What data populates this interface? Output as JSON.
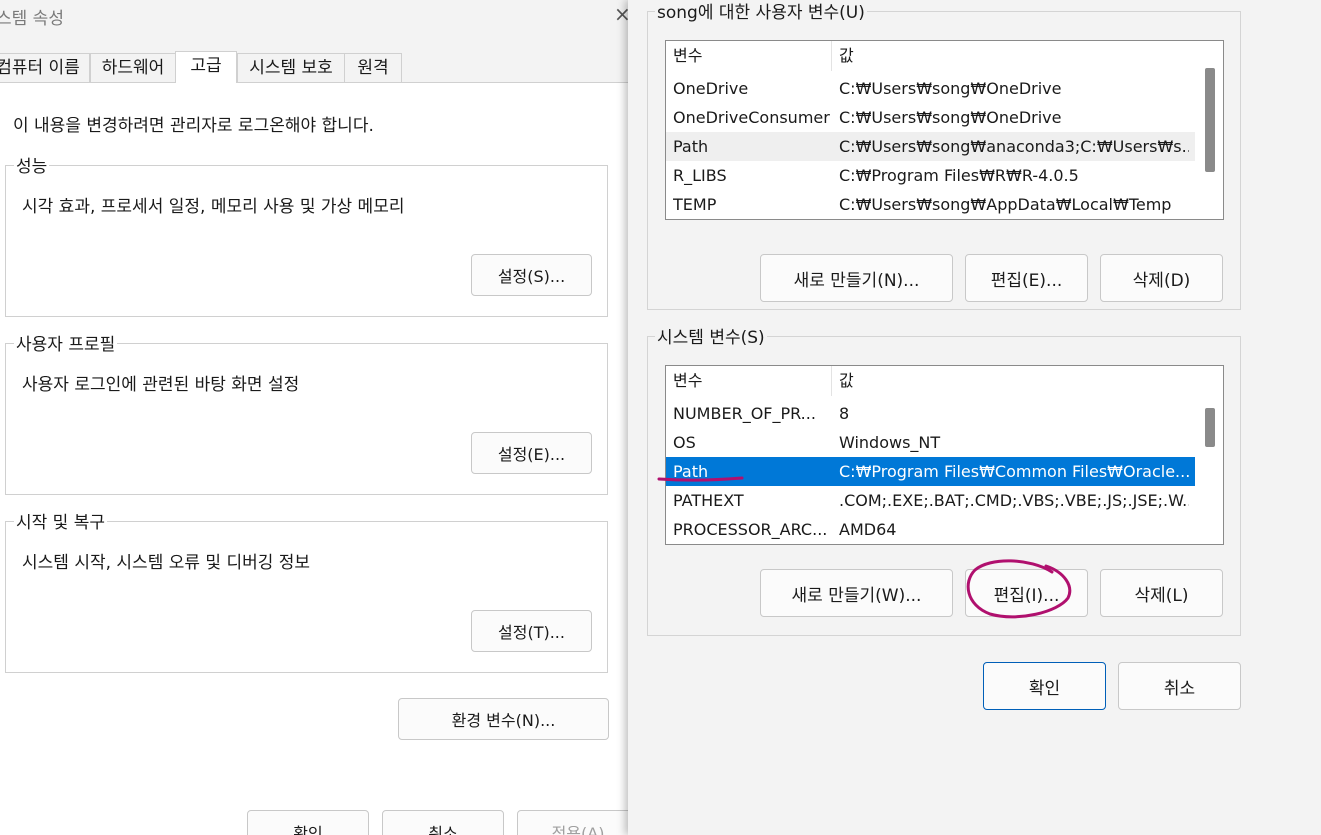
{
  "system_properties": {
    "title": "스템 속성",
    "close_icon": "×",
    "tabs": [
      "컴퓨터 이름",
      "하드웨어",
      "고급",
      "시스템 보호",
      "원격"
    ],
    "active_tab": "고급",
    "admin_note": "이 내용을 변경하려면 관리자로 로그온해야 합니다.",
    "groups": [
      {
        "label": "성능",
        "description": "시각 효과, 프로세서 일정, 메모리 사용 및 가상 메모리",
        "button": "설정(S)..."
      },
      {
        "label": "사용자 프로필",
        "description": "사용자 로그인에 관련된 바탕 화면 설정",
        "button": "설정(E)..."
      },
      {
        "label": "시작 및 복구",
        "description": "시스템 시작, 시스템 오류 및 디버깅 정보",
        "button": "설정(T)..."
      }
    ],
    "env_vars_button": "환경 변수(N)...",
    "footer_buttons": {
      "ok": "확인",
      "cancel": "취소",
      "apply": "적용(A)"
    }
  },
  "environment_variables": {
    "user_vars": {
      "label": "song에 대한 사용자 변수(U)",
      "columns": [
        "변수",
        "값"
      ],
      "rows": [
        {
          "name": "OneDrive",
          "value": "C:₩Users₩song₩OneDrive"
        },
        {
          "name": "OneDriveConsumer",
          "value": "C:₩Users₩song₩OneDrive"
        },
        {
          "name": "Path",
          "value": "C:₩Users₩song₩anaconda3;C:₩Users₩s..."
        },
        {
          "name": "R_LIBS",
          "value": "C:₩Program Files₩R₩R-4.0.5"
        },
        {
          "name": "TEMP",
          "value": "C:₩Users₩song₩AppData₩Local₩Temp"
        }
      ],
      "buttons": {
        "new": "새로 만들기(N)...",
        "edit": "편집(E)...",
        "delete": "삭제(D)"
      }
    },
    "system_vars": {
      "label": "시스템 변수(S)",
      "columns": [
        "변수",
        "값"
      ],
      "rows": [
        {
          "name": "NUMBER_OF_PR...",
          "value": "8"
        },
        {
          "name": "OS",
          "value": "Windows_NT"
        },
        {
          "name": "Path",
          "value": "C:₩Program Files₩Common Files₩Oracle..."
        },
        {
          "name": "PATHEXT",
          "value": ".COM;.EXE;.BAT;.CMD;.VBS;.VBE;.JS;.JSE;.W..."
        },
        {
          "name": "PROCESSOR_ARC...",
          "value": "AMD64"
        }
      ],
      "selected_row": "Path",
      "buttons": {
        "new": "새로 만들기(W)...",
        "edit": "편집(I)...",
        "delete": "삭제(L)"
      }
    },
    "footer_buttons": {
      "ok": "확인",
      "cancel": "취소"
    }
  },
  "colors": {
    "selection": "#0078d7",
    "annotation": "#b0106e",
    "primary_border": "#005fb8"
  }
}
